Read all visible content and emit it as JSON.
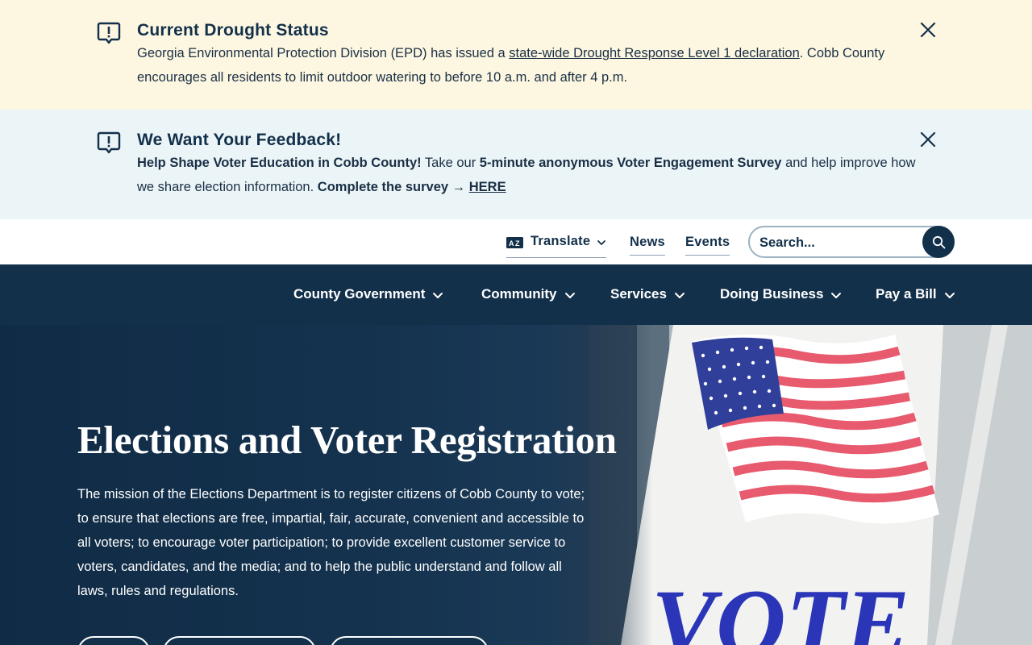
{
  "alerts": {
    "drought": {
      "title": "Current Drought Status",
      "text_before": "Georgia Environmental Protection Division (EPD) has issued a ",
      "link": "state-wide Drought Response Level 1 declaration",
      "text_after": ". Cobb County encourages all residents to limit outdoor watering to before 10 a.m. and after 4 p.m.",
      "icon": "alert-message-icon",
      "close_icon": "close-icon"
    },
    "feedback": {
      "title": "We Want Your Feedback!",
      "bold_lead": "Help Shape Voter Education in Cobb County!",
      "text_1": " Take our ",
      "bold_survey": "5-minute anonymous Voter Engagement Survey",
      "text_2": " and help improve how we share election information. ",
      "bold_cta": "Complete the survey → ",
      "link": "HERE",
      "icon": "alert-message-icon",
      "close_icon": "close-icon"
    }
  },
  "utility": {
    "translate_label": "Translate",
    "news_label": "News",
    "events_label": "Events",
    "search_placeholder": "Search..."
  },
  "nav": {
    "items": [
      {
        "label": "County Government"
      },
      {
        "label": "Community"
      },
      {
        "label": "Services"
      },
      {
        "label": "Doing Business"
      },
      {
        "label": "Pay a Bill"
      }
    ]
  },
  "hero": {
    "title": "Elections and Voter Registration",
    "text": "The mission of the Elections Department is to register citizens of Cobb County to vote; to ensure that elections are free, impartial, fair, accurate, convenient and accessible to all voters; to encourage voter participation; to provide excellent customer service to voters, candidates, and the media; and to help the public understand and follow all laws, rules and regulations.",
    "photo_sign_text": "VOTE"
  },
  "colors": {
    "navy": "#13304b",
    "alert_yellow": "#fdf7e1",
    "alert_blue": "#ebf4f7"
  }
}
